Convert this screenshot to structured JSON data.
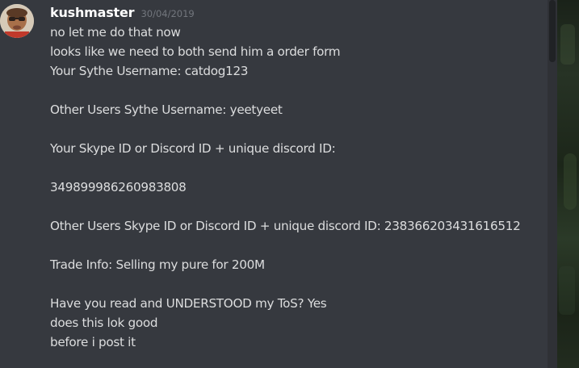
{
  "message": {
    "username": "kushmaster",
    "timestamp": "30/04/2019",
    "lines": [
      "no let me do that now",
      "looks like we need to both send him a order form",
      "Your Sythe Username: catdog123",
      "",
      "Other Users Sythe Username: yeetyeet",
      "",
      "Your Skype ID or Discord ID + unique discord ID:",
      "",
      "349899986260983808",
      "",
      "Other Users Skype ID or Discord ID + unique discord ID: 238366203431616512",
      "",
      "Trade Info: Selling my pure for 200M",
      "",
      "Have you read and UNDERSTOOD my ToS? Yes",
      "does this lok good",
      "before i post it"
    ]
  },
  "colors": {
    "background": "#36393f",
    "username": "#ffffff",
    "text": "#dcddde",
    "timestamp": "#72767d",
    "scrollbar_thumb": "#202225",
    "scrollbar_track": "#2f3136"
  }
}
